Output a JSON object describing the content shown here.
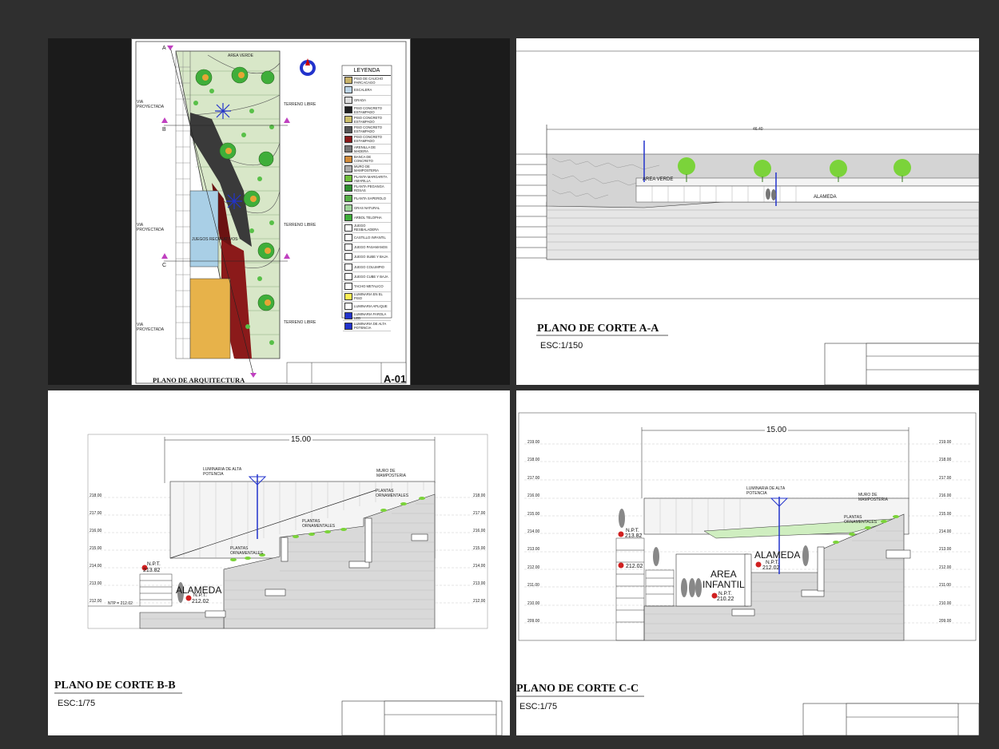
{
  "panels": {
    "architecture": {
      "title": "PLANO DE ARQUITECTURA",
      "sheet_code": "A-01",
      "legend_title": "LEYENDA",
      "legend_items": [
        {
          "label": "PISO DE CAUCHO PARCACAGO",
          "color": "#c9b36a"
        },
        {
          "label": "ESCALERA",
          "color": "#bcd4e6"
        },
        {
          "label": "GRADA",
          "color": "#dddddd"
        },
        {
          "label": "PISO CONCRETO ESTAMPADO",
          "color": "#222222"
        },
        {
          "label": "PISO CONCRETO ESTAMPADO",
          "color": "#cdbf6a"
        },
        {
          "label": "PISO CONCRETO ESTAMPADO",
          "color": "#555555"
        },
        {
          "label": "PISO CONCRETO ESTAMPADO",
          "color": "#8b1a1a"
        },
        {
          "label": "ARENILLA DE MADERA",
          "color": "#777777"
        },
        {
          "label": "BANCA DE CONCRETO",
          "color": "#d28b3a"
        },
        {
          "label": "MURO DE MAMPOSTERIA",
          "color": "#aaaaaa"
        },
        {
          "label": "PLANTA MARGARITA AMARILLA",
          "color": "#6fbf3a"
        },
        {
          "label": "PLANTA PEGANGA ROSAS",
          "color": "#2f8f2f"
        },
        {
          "label": "PLANTA SAPEROLO",
          "color": "#58b048"
        },
        {
          "label": "GRAS NATURAL",
          "color": "#9fd39a"
        },
        {
          "label": "ARBOL TELOPHA",
          "color": "#3fae3a"
        },
        {
          "label": "JUEGO RESBALADERA",
          "color": "#ffffff"
        },
        {
          "label": "CASTILLO INFANTIL",
          "color": "#ffffff"
        },
        {
          "label": "JUEGO PASAMANOS",
          "color": "#ffffff"
        },
        {
          "label": "JUEGO SUBE Y BAJA",
          "color": "#ffffff"
        },
        {
          "label": "JUEGO COLUMPIO",
          "color": "#ffffff"
        },
        {
          "label": "JUEGO CUBE Y BAJA",
          "color": "#ffffff"
        },
        {
          "label": "TACHO METALICO",
          "color": "#ffffff"
        },
        {
          "label": "LUMINARIA EN EL PISO",
          "color": "#ffee55"
        },
        {
          "label": "LUMINARIA APLIQUE",
          "color": "#ffffff"
        },
        {
          "label": "LUMINARIA FAROLA LED",
          "color": "#2233cc"
        },
        {
          "label": "LUMINARIA DE ALTA POTENCIA",
          "color": "#2233cc"
        }
      ],
      "labels": {
        "via_proyectada": "VIA PROYECTADA",
        "terreno_libre": "TERRENO LIBRE",
        "area_verde": "AREA VERDE",
        "juegos": "JUEGOS RECREATIVOS"
      },
      "cut_marks": [
        "A",
        "B",
        "C"
      ]
    },
    "cut_aa": {
      "title": "PLANO DE CORTE A-A",
      "scale": "ESC:1/150",
      "dimension": "46.40",
      "labels": {
        "area_verde": "AREA VERDE",
        "alameda": "ALAMEDA"
      }
    },
    "cut_bb": {
      "title": "PLANO DE CORTE B-B",
      "scale": "ESC:1/75",
      "dimension": "15.00",
      "labels": {
        "alameda": "ALAMEDA",
        "npt_1": "N.P.T.",
        "npt_1_val": "213.82",
        "npt_2": "N.P.T.",
        "npt_2_val": "212.02",
        "luminaria": "LUMINARIA DE ALTA POTENCIA",
        "muro": "MURO DE MAMPOSTERIA",
        "plantas": "PLANTAS ORNAMENTALES",
        "limite": "LIMITE DEL TERRENO",
        "ntp": "NTP = 212.02"
      },
      "levels": [
        "218.00",
        "217.00",
        "216.00",
        "215.00",
        "214.00",
        "213.00",
        "212.00"
      ]
    },
    "cut_cc": {
      "title": "PLANO DE CORTE C-C",
      "scale": "ESC:1/75",
      "dimension": "15.00",
      "labels": {
        "alameda": "ALAMEDA",
        "area_infantil_1": "AREA",
        "area_infantil_2": "INFANTIL",
        "npt": "N.P.T.",
        "npt_a": "213.82",
        "npt_b": "212.02",
        "npt_c": "212.02",
        "npt_d": "210.22",
        "limite": "LIMITE DEL TERRENO",
        "luminaria": "LUMINARIA DE ALTA POTENCIA",
        "plantas": "PLANTAS ORNAMENTALES",
        "muro": "MURO DE MAMPOSTERIA"
      },
      "levels": [
        "219.00",
        "218.00",
        "217.00",
        "216.00",
        "215.00",
        "214.00",
        "213.00",
        "212.00",
        "211.00",
        "210.00",
        "209.00"
      ]
    }
  }
}
